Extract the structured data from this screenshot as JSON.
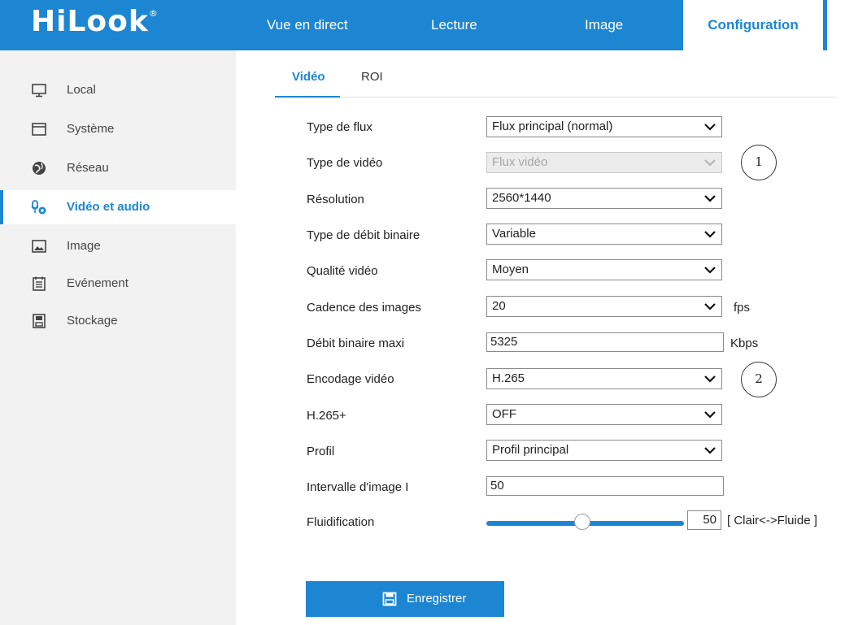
{
  "header": {
    "logo": "HiLook",
    "logo_mark": "®",
    "tabs": [
      "Vue en direct",
      "Lecture",
      "Image",
      "Configuration"
    ],
    "active_tab": "Configuration"
  },
  "sidebar": {
    "items": [
      {
        "label": "Local",
        "icon": "monitor-icon"
      },
      {
        "label": "Système",
        "icon": "window-icon"
      },
      {
        "label": "Réseau",
        "icon": "globe-icon"
      },
      {
        "label": "Vidéo et audio",
        "icon": "video-audio-icon"
      },
      {
        "label": "Image",
        "icon": "image-icon"
      },
      {
        "label": "Evénement",
        "icon": "calendar-icon"
      },
      {
        "label": "Stockage",
        "icon": "storage-icon"
      }
    ],
    "active": "Vidéo et audio"
  },
  "subtabs": {
    "items": [
      "Vidéo",
      "ROI"
    ],
    "active": "Vidéo"
  },
  "form": {
    "stream_type": {
      "label": "Type de flux",
      "value": "Flux principal (normal)"
    },
    "video_type": {
      "label": "Type de vidéo",
      "value": "Flux vidéo"
    },
    "resolution": {
      "label": "Résolution",
      "value": "2560*1440"
    },
    "bitrate_type": {
      "label": "Type de débit binaire",
      "value": "Variable"
    },
    "video_quality": {
      "label": "Qualité vidéo",
      "value": "Moyen"
    },
    "frame_rate": {
      "label": "Cadence des images",
      "value": "20",
      "unit": "fps"
    },
    "max_bitrate": {
      "label": "Débit binaire maxi",
      "value": "5325",
      "unit": "Kbps"
    },
    "video_encoding": {
      "label": "Encodage vidéo",
      "value": "H.265"
    },
    "h265_plus": {
      "label": "H.265+",
      "value": "OFF"
    },
    "profile": {
      "label": "Profil",
      "value": "Profil principal"
    },
    "i_frame_interval": {
      "label": "Intervalle d'image I",
      "value": "50"
    },
    "smoothing": {
      "label": "Fluidification",
      "value": "50",
      "range_label": "[ Clair<->Fluide ]",
      "level_fraction": 0.5
    }
  },
  "annotations": {
    "marker1": "1",
    "marker2": "2"
  },
  "save_button": {
    "label": "Enregistrer"
  },
  "colors": {
    "accent": "#1d86d3",
    "sidebar_bg": "#f2f2f2"
  }
}
